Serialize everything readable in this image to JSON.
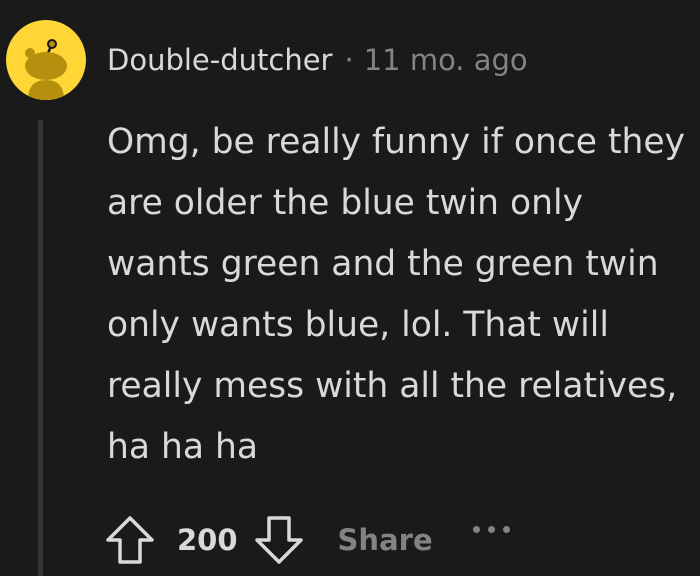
{
  "comment": {
    "username": "Double-dutcher",
    "separator": "·",
    "timestamp": "11 mo. ago",
    "avatar_icon": "snoo-avatar-icon",
    "avatar_color": "#ffd635",
    "body": "Omg, be really funny if once they are older the blue twin only wants green and the green twin only wants blue, lol. That will really mess with all the relatives, ha ha ha",
    "actions": {
      "upvote_icon": "upvote-arrow-icon",
      "score": "200",
      "downvote_icon": "downvote-arrow-icon",
      "share_label": "Share",
      "more_icon": "more-options-icon"
    }
  },
  "colors": {
    "background": "#1a1a1b",
    "text": "#d7dadc",
    "muted": "#818384",
    "thread_line": "#343536"
  }
}
